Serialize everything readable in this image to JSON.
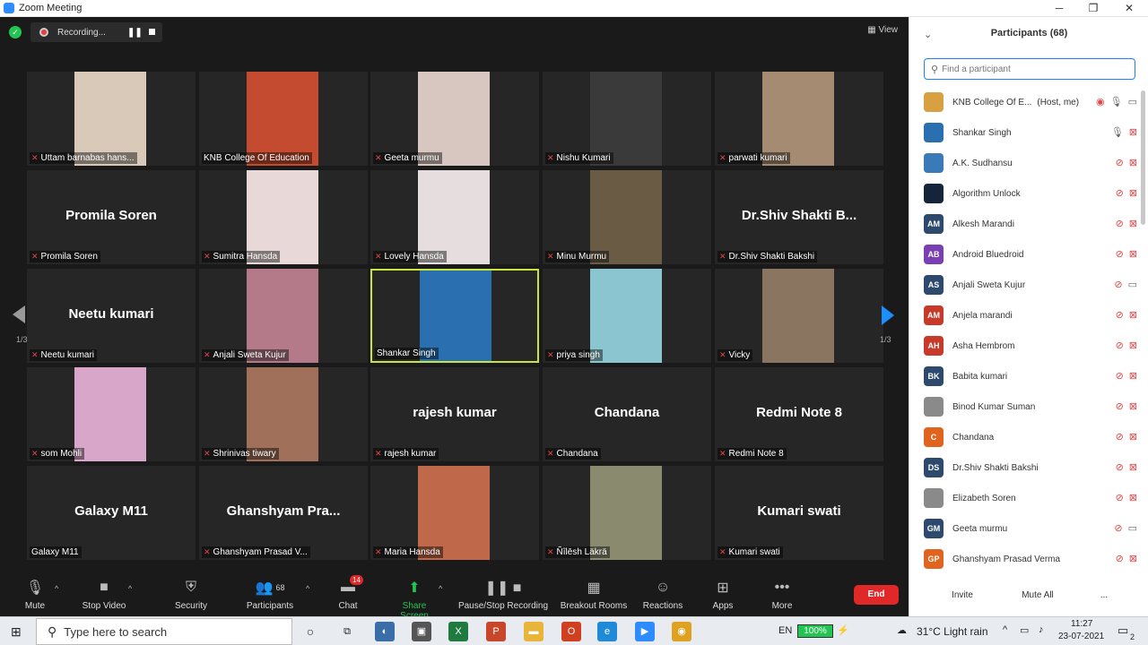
{
  "window": {
    "title": "Zoom Meeting",
    "minimize": "─",
    "maximize": "❐",
    "close": "✕"
  },
  "recording": {
    "label": "Recording...",
    "pause": "❚❚"
  },
  "view_label": "View",
  "pager": {
    "left_page": "1/3",
    "right_page": "1/3"
  },
  "tiles": [
    {
      "name": "Uttam barnabas hans...",
      "display": "",
      "video": true,
      "video_color": "#d9c9b8",
      "muted": true
    },
    {
      "name": "KNB College Of Education",
      "display": "",
      "video": true,
      "video_color": "#c44b2f",
      "muted": false
    },
    {
      "name": "Geeta murmu",
      "display": "",
      "video": true,
      "video_color": "#d8c6c0",
      "muted": true
    },
    {
      "name": "Nishu Kumari",
      "display": "",
      "video": true,
      "video_color": "#3a3a3a",
      "muted": true
    },
    {
      "name": "parwati kumari",
      "display": "",
      "video": true,
      "video_color": "#a58b72",
      "muted": true
    },
    {
      "name": "Promila Soren",
      "display": "Promila Soren",
      "video": false,
      "muted": true
    },
    {
      "name": "Sumitra Hansda",
      "display": "",
      "video": true,
      "video_color": "#e8d8d8",
      "muted": true
    },
    {
      "name": "Lovely Hansda",
      "display": "",
      "video": true,
      "video_color": "#e6dede",
      "muted": true
    },
    {
      "name": "Minu Murmu",
      "display": "",
      "video": true,
      "video_color": "#6a5b45",
      "muted": true
    },
    {
      "name": "Dr.Shiv Shakti Bakshi",
      "display": "Dr.Shiv Shakti B...",
      "video": false,
      "muted": true
    },
    {
      "name": "Neetu kumari",
      "display": "Neetu kumari",
      "video": false,
      "muted": true
    },
    {
      "name": "Anjali Sweta Kujur",
      "display": "",
      "video": true,
      "video_color": "#b47a8a",
      "muted": true
    },
    {
      "name": "Shankar Singh",
      "display": "",
      "video": true,
      "video_color": "#2a6fb0",
      "muted": false,
      "active": true
    },
    {
      "name": "priya singh",
      "display": "",
      "video": true,
      "video_color": "#8bc6d0",
      "muted": true
    },
    {
      "name": "Vicky",
      "display": "",
      "video": true,
      "video_color": "#8a7560",
      "muted": true
    },
    {
      "name": "som Mohli",
      "display": "",
      "video": true,
      "video_color": "#d7a6c8",
      "muted": true
    },
    {
      "name": "Shrinivas tiwary",
      "display": "",
      "video": true,
      "video_color": "#a0705a",
      "muted": true
    },
    {
      "name": "rajesh kumar",
      "display": "rajesh kumar",
      "video": false,
      "muted": true
    },
    {
      "name": "Chandana",
      "display": "Chandana",
      "video": false,
      "muted": true
    },
    {
      "name": "Redmi Note 8",
      "display": "Redmi Note 8",
      "video": false,
      "muted": true
    },
    {
      "name": "Galaxy M11",
      "display": "Galaxy M11",
      "video": false,
      "muted": false
    },
    {
      "name": "Ghanshyam Prasad V...",
      "display": "Ghanshyam  Pra...",
      "video": false,
      "muted": true
    },
    {
      "name": "Maria Hansda",
      "display": "",
      "video": true,
      "video_color": "#c0684a",
      "muted": true
    },
    {
      "name": "Ñîlēsh Läkrä",
      "display": "",
      "video": true,
      "video_color": "#8a8a6e",
      "muted": true
    },
    {
      "name": "Kumari swati",
      "display": "Kumari swati",
      "video": false,
      "muted": true
    }
  ],
  "toolbar": {
    "mute": "Mute",
    "stop_video": "Stop Video",
    "security": "Security",
    "participants": "Participants",
    "participants_count": "68",
    "chat": "Chat",
    "chat_badge": "14",
    "share_screen": "Share Screen",
    "pause_stop_recording": "Pause/Stop Recording",
    "breakout_rooms": "Breakout Rooms",
    "reactions": "Reactions",
    "apps": "Apps",
    "more": "More",
    "end": "End"
  },
  "panel": {
    "title": "Participants (68)",
    "search_placeholder": "Find a participant",
    "invite": "Invite",
    "mute_all": "Mute All",
    "more": "...",
    "participants": [
      {
        "name": "KNB College Of E...",
        "tag": "(Host, me)",
        "initials": "",
        "color": "#d8a040",
        "mic": "on",
        "cam": "on",
        "rec": true
      },
      {
        "name": "Shankar Singh",
        "tag": "",
        "initials": "",
        "color": "#2a6fb0",
        "mic": "on",
        "cam": "off"
      },
      {
        "name": "A.K. Sudhansu",
        "tag": "",
        "initials": "",
        "color": "#3a7ab8",
        "mic": "off",
        "cam": "off"
      },
      {
        "name": "Algorithm Unlock",
        "tag": "",
        "initials": "",
        "color": "#14253a",
        "mic": "off",
        "cam": "off"
      },
      {
        "name": "Alkesh Marandi",
        "tag": "",
        "initials": "AM",
        "color": "#2d4a6e",
        "mic": "off",
        "cam": "off"
      },
      {
        "name": "Android Bluedroid",
        "tag": "",
        "initials": "AB",
        "color": "#7a3fb3",
        "mic": "off",
        "cam": "off"
      },
      {
        "name": "Anjali Sweta Kujur",
        "tag": "",
        "initials": "AS",
        "color": "#2d4a6e",
        "mic": "off",
        "cam": "on"
      },
      {
        "name": "Anjela marandi",
        "tag": "",
        "initials": "AM",
        "color": "#c73a2a",
        "mic": "off",
        "cam": "off"
      },
      {
        "name": "Asha Hembrom",
        "tag": "",
        "initials": "AH",
        "color": "#c73a2a",
        "mic": "off",
        "cam": "off"
      },
      {
        "name": "Babita kumari",
        "tag": "",
        "initials": "BK",
        "color": "#2d4a6e",
        "mic": "off",
        "cam": "off"
      },
      {
        "name": "Binod Kumar Suman",
        "tag": "",
        "initials": "",
        "color": "#8a8a8a",
        "mic": "off",
        "cam": "off"
      },
      {
        "name": "Chandana",
        "tag": "",
        "initials": "C",
        "color": "#e0641e",
        "mic": "off",
        "cam": "off"
      },
      {
        "name": "Dr.Shiv Shakti Bakshi",
        "tag": "",
        "initials": "DS",
        "color": "#2d4a6e",
        "mic": "off",
        "cam": "off"
      },
      {
        "name": "Elizabeth Soren",
        "tag": "",
        "initials": "",
        "color": "#8a8a8a",
        "mic": "off",
        "cam": "off"
      },
      {
        "name": "Geeta murmu",
        "tag": "",
        "initials": "GM",
        "color": "#2d4a6e",
        "mic": "off",
        "cam": "on"
      },
      {
        "name": "Ghanshyam Prasad Verma",
        "tag": "",
        "initials": "GP",
        "color": "#e0641e",
        "mic": "off",
        "cam": "off"
      }
    ]
  },
  "taskbar": {
    "search_placeholder": "Type here to search",
    "lang": "EN",
    "battery": "100%",
    "weather": "31°C  Light rain",
    "time": "11:27",
    "date": "23-07-2021",
    "notif": "2"
  }
}
